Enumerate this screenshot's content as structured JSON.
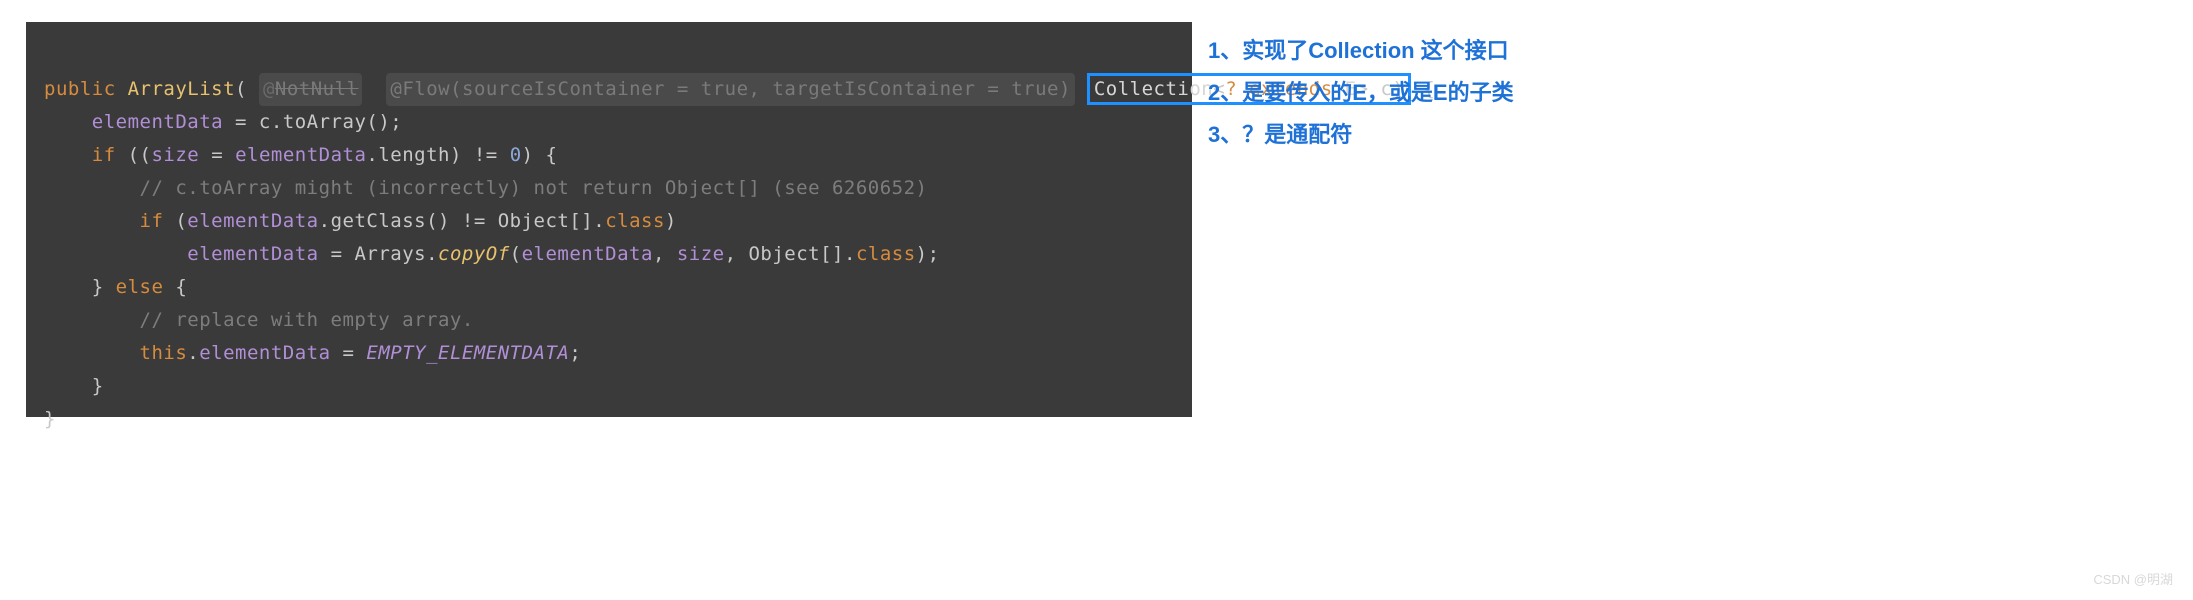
{
  "code": {
    "l1_public": "public",
    "l1_fn": "ArrayList",
    "l1_anno1_at": "@",
    "l1_anno1_name": "NotNull",
    "l1_anno2": "@Flow(sourceIsContainer = true, targetIsContainer = true)",
    "l1_type_coll": "Collection",
    "l1_lt": "<",
    "l1_q": "?",
    "l1_extends": " extends ",
    "l1_E": "E",
    "l1_gt": ">",
    "l1_param": " c)",
    "l1_brace": " {",
    "l2_field": "elementData",
    "l2_rest": " = c.toArray();",
    "l3_if": "if",
    "l3_open": " ((",
    "l3_size": "size",
    "l3_eq": " = ",
    "l3_ed": "elementData",
    "l3_len": ".length) != ",
    "l3_zero": "0",
    "l3_close": ") {",
    "l4_comment": "// c.toArray might (incorrectly) not return Object[] (see 6260652)",
    "l5_if": "if",
    "l5_open": " (",
    "l5_ed": "elementData",
    "l5_get": ".getClass() != Object[].",
    "l5_class": "class",
    "l5_close": ")",
    "l6_ed": "elementData",
    "l6_eq": " = Arrays.",
    "l6_copy": "copyOf",
    "l6_open": "(",
    "l6_ed2": "elementData",
    "l6_comma1": ", ",
    "l6_size": "size",
    "l6_comma2": ", Object[].",
    "l6_class": "class",
    "l6_close": ");",
    "l7_close": "} ",
    "l7_else": "else",
    "l7_open": " {",
    "l8_comment": "// replace with empty array.",
    "l9_this": "this",
    "l9_dot": ".",
    "l9_ed": "elementData",
    "l9_eq": " = ",
    "l9_const": "EMPTY_ELEMENTDATA",
    "l9_semi": ";",
    "l10": "}",
    "l11": "}"
  },
  "notes": {
    "n1": "1、实现了Collection 这个接口",
    "n2": "2、是要传入的E，或是E的子类",
    "n3": "3、？是通配符"
  },
  "watermark": "CSDN @明湖"
}
